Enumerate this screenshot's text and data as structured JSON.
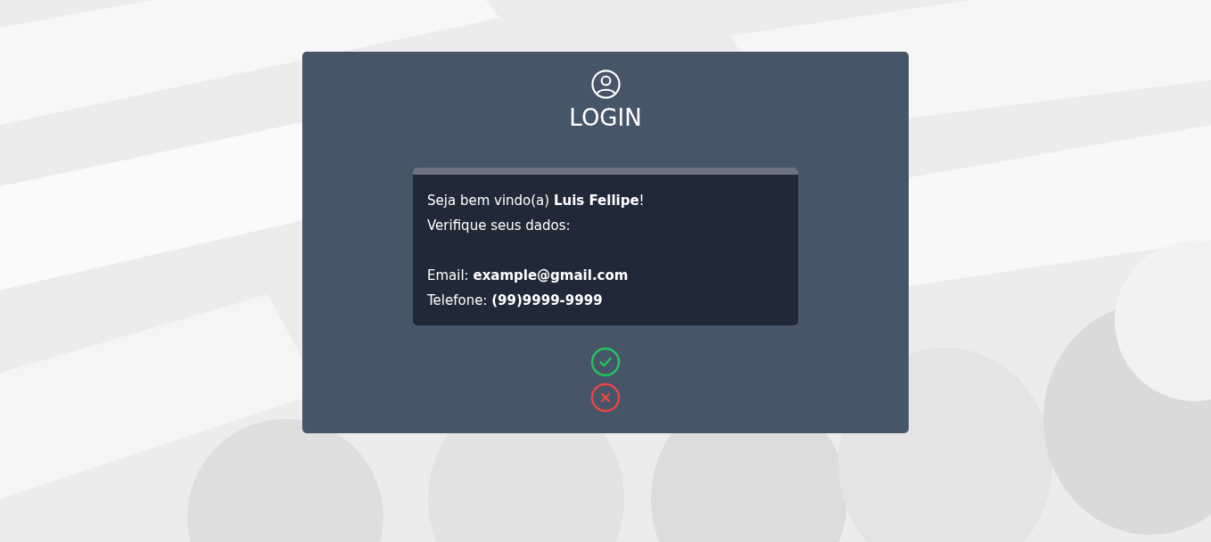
{
  "login": {
    "title": "LOGIN",
    "message": {
      "paragraphs": [
        [
          "Seja bem vindo(a) **Luis Fellipe**!",
          "Verifique seus dados:"
        ],
        [
          "Email: **example@gmail.com**",
          "Telefone: **(99)9999-9999**"
        ]
      ]
    },
    "actions": [
      {
        "kind": "confirm"
      },
      {
        "kind": "cancel"
      }
    ]
  }
}
